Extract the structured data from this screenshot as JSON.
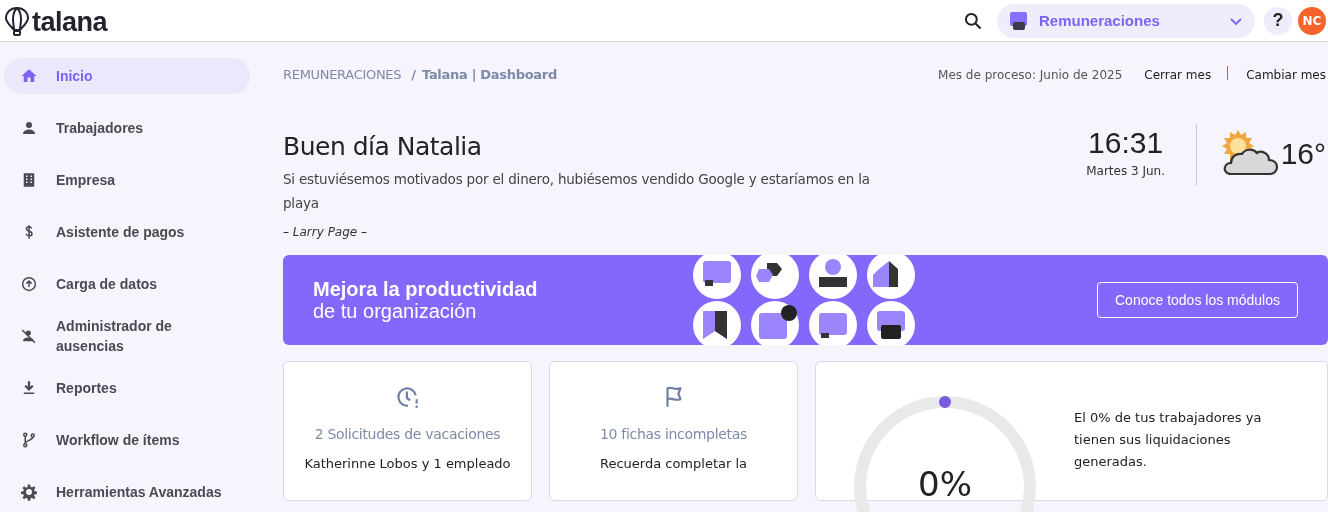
{
  "header": {
    "logo": "talana",
    "product": "Remuneraciones",
    "help": "?",
    "avatar": "NC"
  },
  "sidebar": {
    "items": [
      {
        "label": "Inicio",
        "selected": true
      },
      {
        "label": "Trabajadores",
        "selected": false
      },
      {
        "label": "Empresa",
        "selected": false
      },
      {
        "label": "Asistente de pagos",
        "selected": false
      },
      {
        "label": "Carga de datos",
        "selected": false
      },
      {
        "label": "Administrador de ausencias",
        "selected": false
      },
      {
        "label": "Reportes",
        "selected": false
      },
      {
        "label": "Workflow de ítems",
        "selected": false
      },
      {
        "label": "Herramientas Avanzadas",
        "selected": false
      }
    ]
  },
  "breadcrumb": {
    "section": "REMUNERACIONES",
    "separator": "/",
    "page": "Talana | Dashboard"
  },
  "process": {
    "label": "Mes de proceso: Junio de 2025",
    "actions": [
      "Cerrar mes",
      "Cambiar mes"
    ]
  },
  "greeting": {
    "title": "Buen día Natalia",
    "quote": "Si estuviésemos motivados por el dinero, hubiésemos vendido Google y estaríamos en la playa",
    "author": "– Larry Page –"
  },
  "clock": {
    "time": "16:31",
    "date": "Martes 3 Jun."
  },
  "weather": {
    "temperature": "16°"
  },
  "banner": {
    "title_line1": "Mejora la productividad",
    "title_line2": "de tu organización",
    "button": "Conoce todos los módulos"
  },
  "cards": [
    {
      "title": "2 Solicitudes de vacaciones",
      "text": "Katherinne Lobos y 1 empleado"
    },
    {
      "title": "10 fichas incompletas",
      "text": "Recuerda completar la"
    }
  ],
  "settlements": {
    "level": 0,
    "percent": "0%",
    "text": "El 0% de tus trabajadores ya tienen sus liquidaciones generadas."
  }
}
